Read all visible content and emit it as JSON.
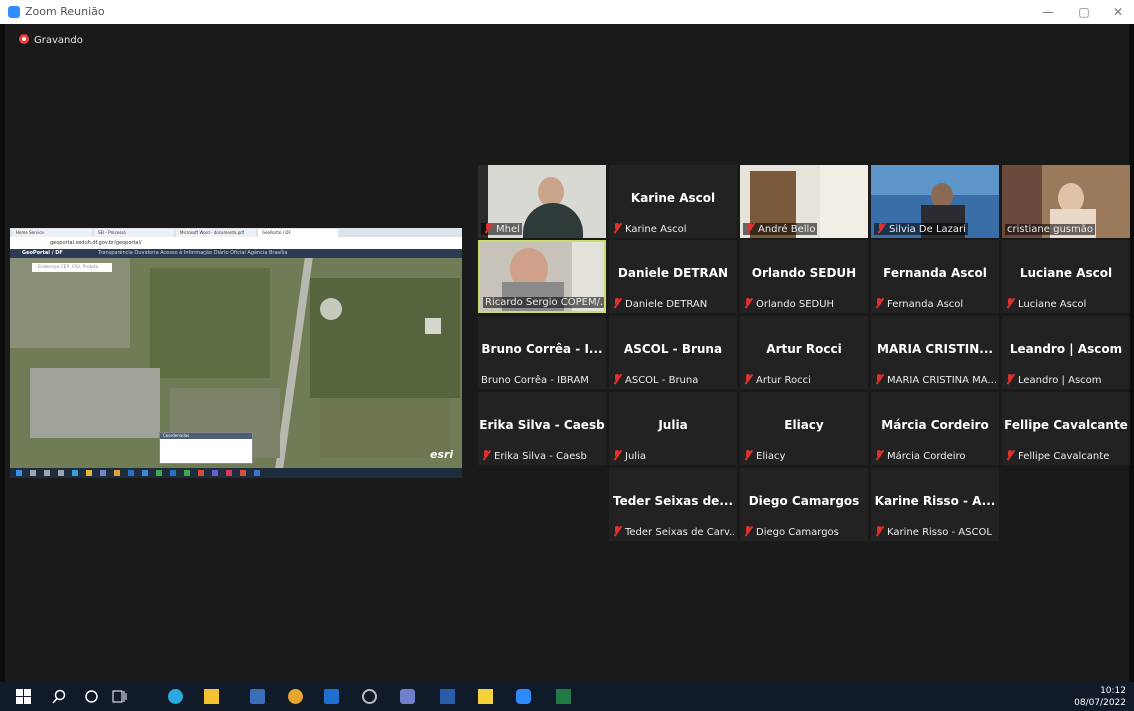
{
  "window": {
    "title": "Zoom Reunião",
    "minimize": "—",
    "maximize": "▢",
    "close": "✕"
  },
  "recording": "Gravando",
  "share": {
    "tabs": [
      "Home Service",
      "SEI - Processo",
      "Microsoft Word - documento.pdf",
      "GeoPortal / DF"
    ],
    "url": "geoportal.seduh.df.gov.br/geoportal/",
    "app_title": "GeoPortal / DF",
    "menu": "Transparência   Ouvidoria   Acesso à Informação   Diário Oficial   Agência Brasília",
    "search_placeholder": "Endereço CEP, CIU, Projeto",
    "coords_title": "Coordenadas",
    "logo": "esri"
  },
  "participants": [
    {
      "big": "",
      "label": "Mhel",
      "muted": true,
      "video": true
    },
    {
      "big": "Karine Ascol",
      "label": "Karine Ascol",
      "muted": true,
      "video": false
    },
    {
      "big": "",
      "label": "André Bello",
      "muted": true,
      "video": true
    },
    {
      "big": "",
      "label": "Silvia De Lazari",
      "muted": true,
      "video": true
    },
    {
      "big": "",
      "label": "cristiane gusmão",
      "muted": false,
      "video": true
    },
    {
      "big": "",
      "label": "Ricardo Sergio COPEM/...",
      "muted": false,
      "video": true,
      "active": true
    },
    {
      "big": "Daniele DETRAN",
      "label": "Daniele DETRAN",
      "muted": true,
      "video": false
    },
    {
      "big": "Orlando SEDUH",
      "label": "Orlando SEDUH",
      "muted": true,
      "video": false
    },
    {
      "big": "Fernanda Ascol",
      "label": "Fernanda Ascol",
      "muted": true,
      "video": false
    },
    {
      "big": "Luciane Ascol",
      "label": "Luciane Ascol",
      "muted": true,
      "video": false
    },
    {
      "big": "Bruno Corrêa - I...",
      "label": "Bruno Corrêa - IBRAM",
      "muted": false,
      "video": false
    },
    {
      "big": "ASCOL - Bruna",
      "label": "ASCOL - Bruna",
      "muted": true,
      "video": false
    },
    {
      "big": "Artur Rocci",
      "label": "Artur Rocci",
      "muted": true,
      "video": false
    },
    {
      "big": "MARIA CRISTIN...",
      "label": "MARIA CRISTINA MA...",
      "muted": true,
      "video": false
    },
    {
      "big": "Leandro | Ascom",
      "label": "Leandro | Ascom",
      "muted": true,
      "video": false
    },
    {
      "big": "Erika Silva - Caesb",
      "label": "Erika Silva - Caesb",
      "muted": true,
      "video": false
    },
    {
      "big": "Julia",
      "label": "Julia",
      "muted": true,
      "video": false
    },
    {
      "big": "Eliacy",
      "label": "Eliacy",
      "muted": true,
      "video": false
    },
    {
      "big": "Márcia Cordeiro",
      "label": "Márcia Cordeiro",
      "muted": true,
      "video": false
    },
    {
      "big": "Fellipe Cavalcante",
      "label": "Fellipe Cavalcante",
      "muted": true,
      "video": false
    },
    {
      "big": "Teder Seixas de...",
      "label": "Teder Seixas de Carv...",
      "muted": true,
      "video": false
    },
    {
      "big": "Diego Camargos",
      "label": "Diego Camargos",
      "muted": true,
      "video": false
    },
    {
      "big": "Karine Risso - A...",
      "label": "Karine Risso - ASCOL",
      "muted": true,
      "video": false
    }
  ],
  "taskbar": {
    "icons": [
      "windows-start-icon",
      "search-icon",
      "cortana-icon",
      "task-view-icon",
      "edge-icon",
      "file-explorer-icon",
      "store-icon",
      "chrome-icon",
      "outlook-icon",
      "obs-icon",
      "teams-icon",
      "word-icon",
      "sticky-notes-icon",
      "zoom-icon",
      "excel-icon"
    ],
    "time": "10:12",
    "date": "08/07/2022"
  },
  "colors": {
    "zoom_blue": "#2d8cff",
    "mute_red": "#e0312d",
    "active_border": "#c9dd6a",
    "tile_bg": "#222222"
  }
}
